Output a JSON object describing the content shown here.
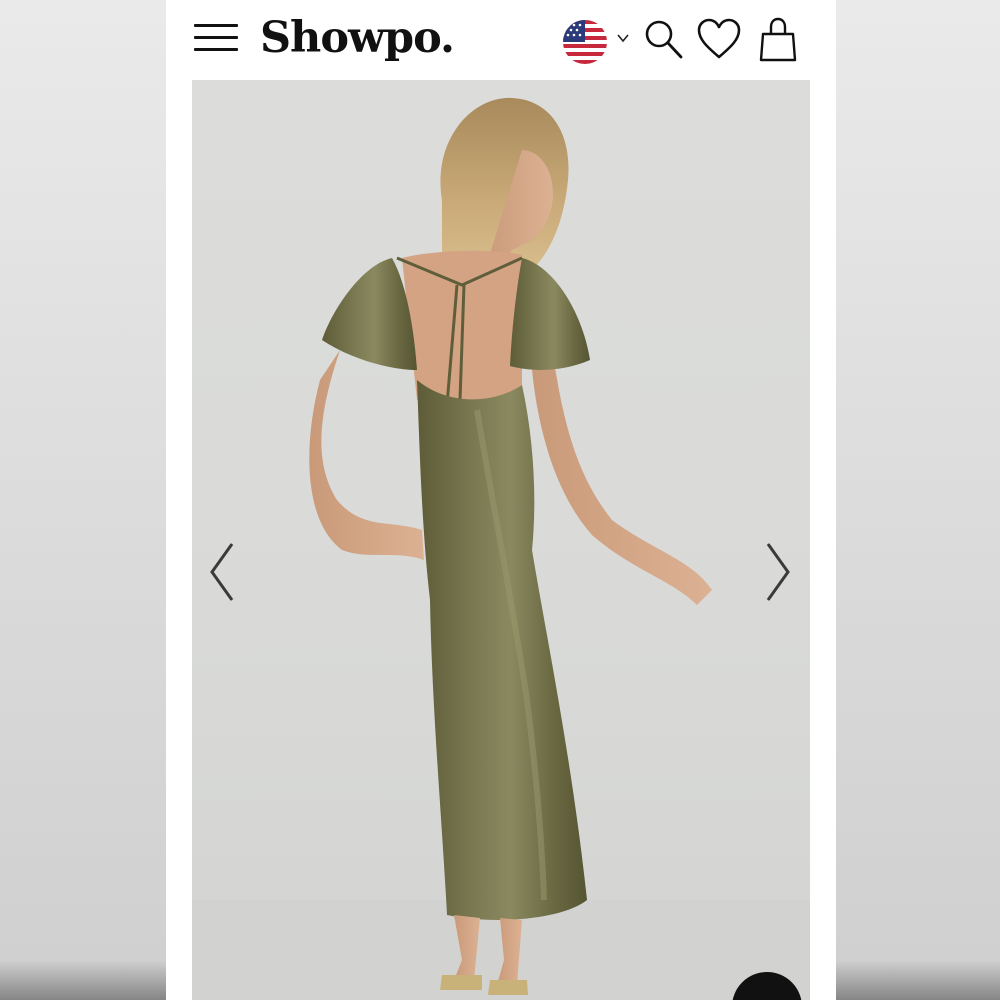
{
  "header": {
    "brand": "Showpo.",
    "icons": [
      "menu-icon",
      "us-flag-icon",
      "chevron-down-icon",
      "search-icon",
      "heart-icon",
      "bag-icon"
    ]
  },
  "gallery": {
    "image_description_icon": "product-photo",
    "prev_icon": "chevron-left-icon",
    "next_icon": "chevron-right-icon"
  },
  "colors": {
    "brand_text": "#111111",
    "background": "#ffffff",
    "photo_backdrop": "#dcdddb",
    "dress": "#6b6a45"
  }
}
